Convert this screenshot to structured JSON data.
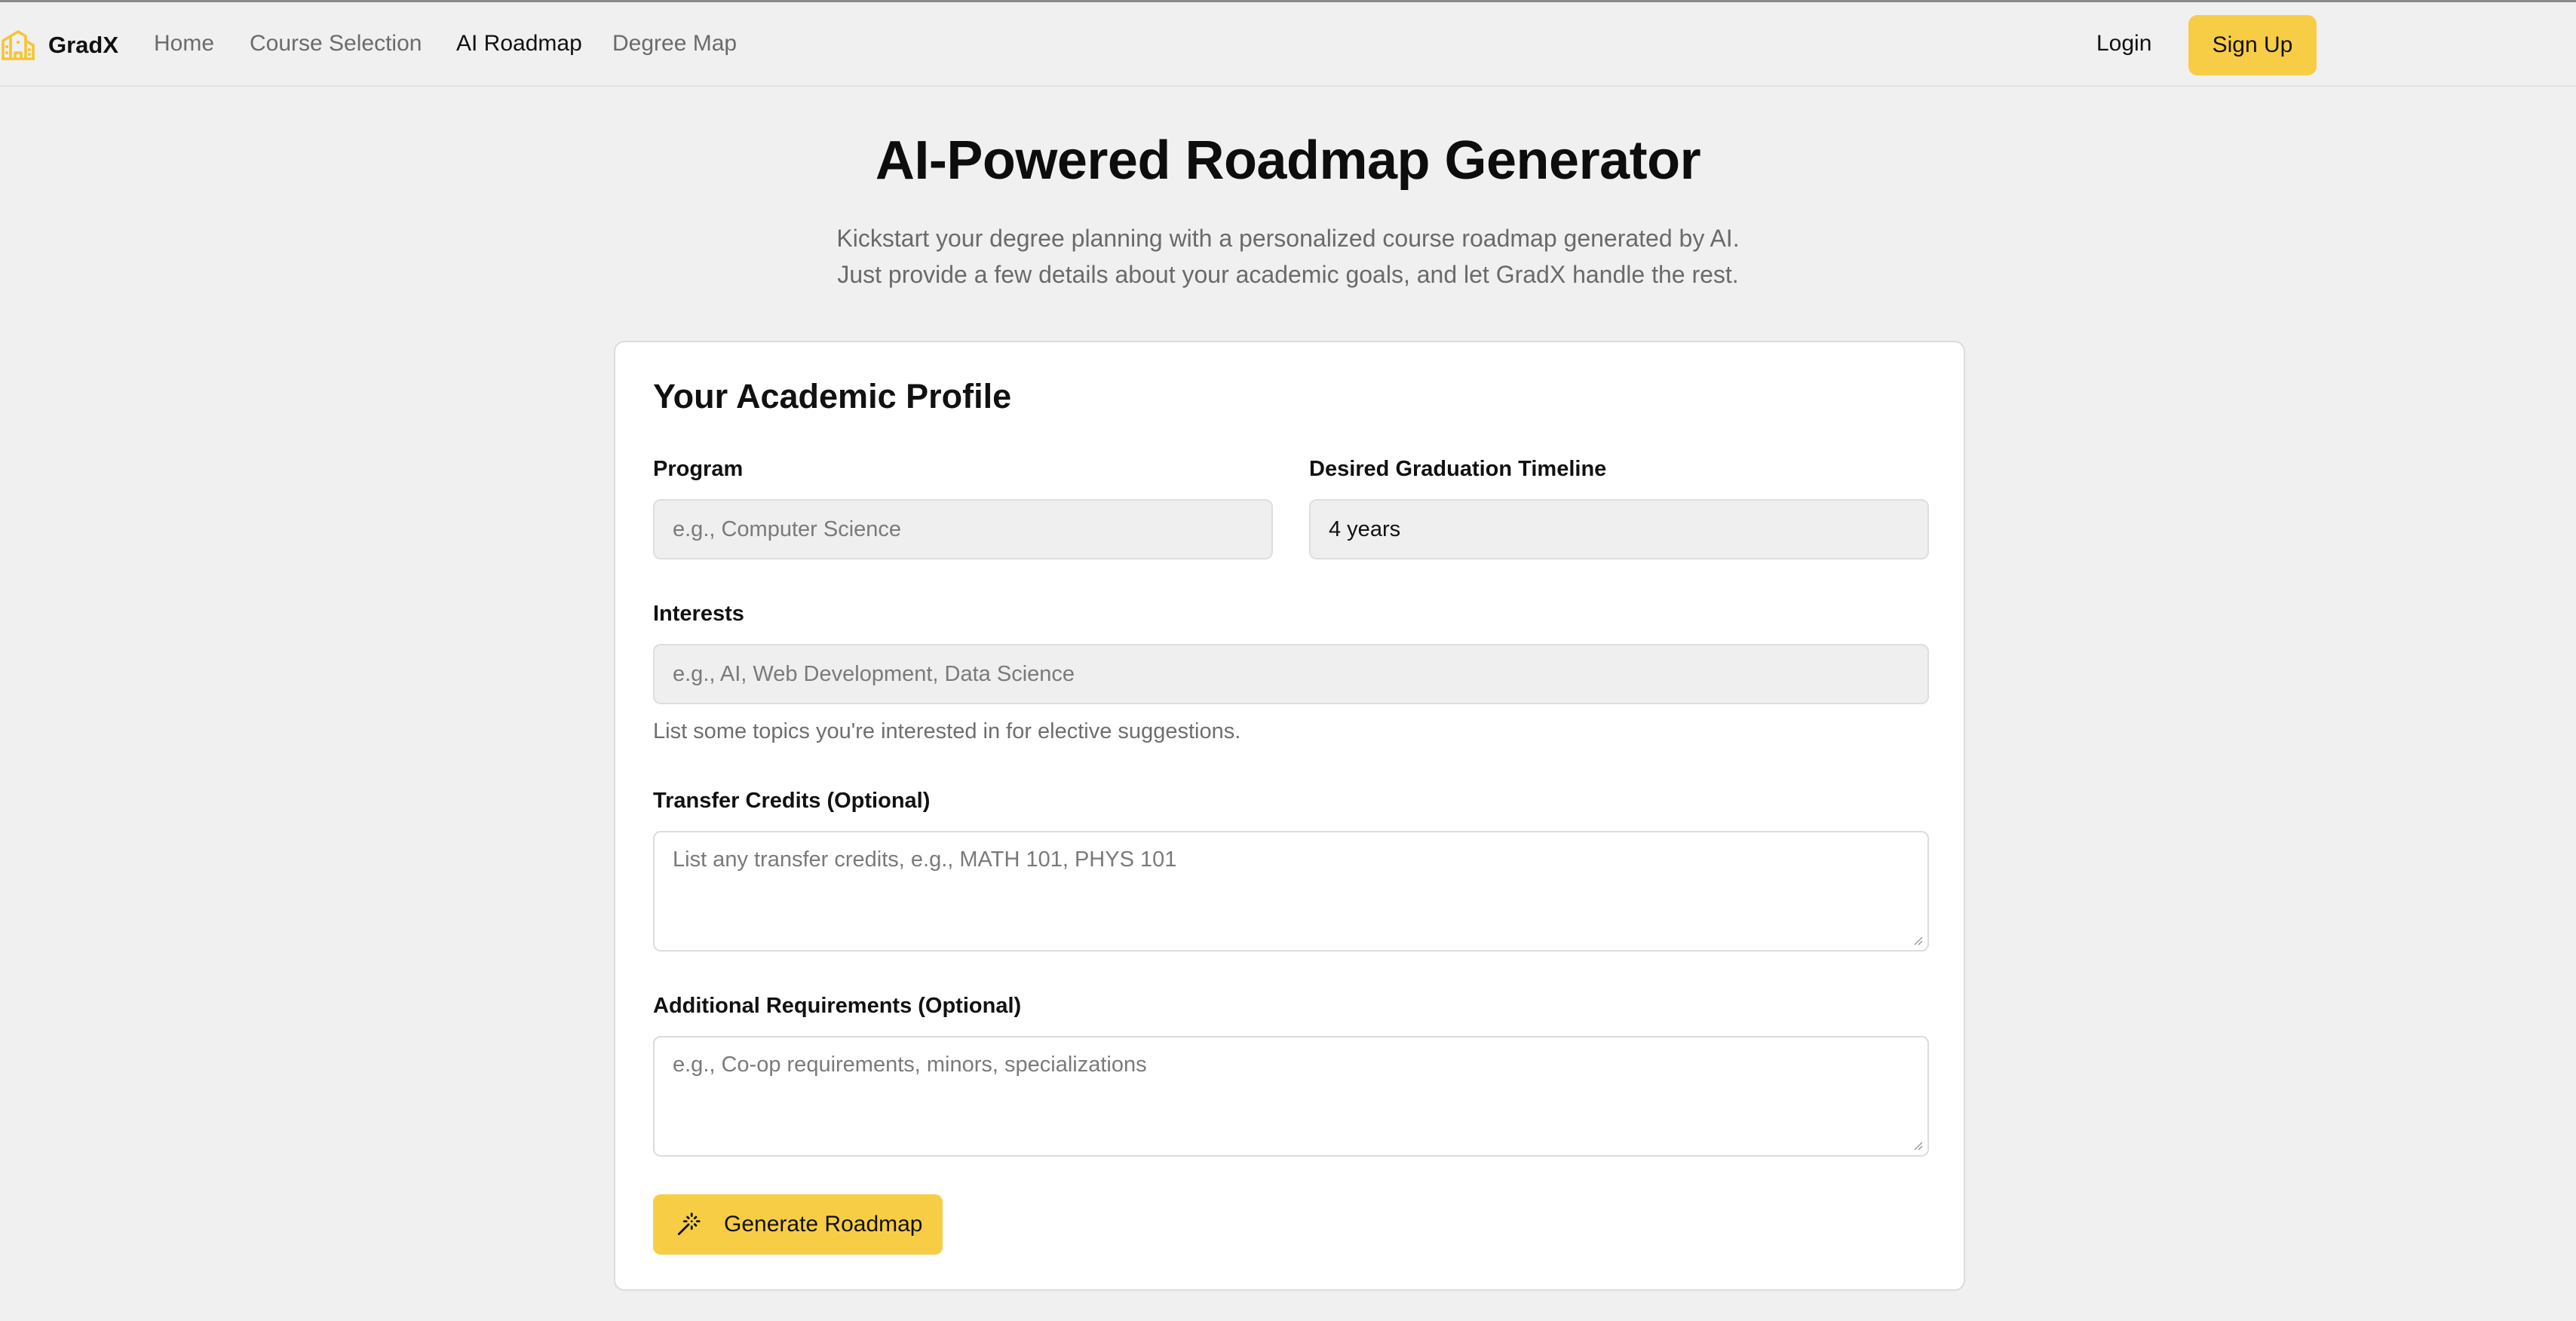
{
  "nav": {
    "brand": "GradX",
    "links": [
      {
        "label": "Home",
        "active": false
      },
      {
        "label": "Course Selection",
        "active": false
      },
      {
        "label": "AI Roadmap",
        "active": true
      },
      {
        "label": "Degree Map",
        "active": false
      }
    ],
    "login": "Login",
    "signup": "Sign Up",
    "accent_color": "#f8cd46"
  },
  "hero": {
    "title": "AI-Powered Roadmap Generator",
    "subtitle_line1": "Kickstart your degree planning with a personalized course roadmap generated by AI.",
    "subtitle_line2": "Just provide a few details about your academic goals, and let GradX handle the rest."
  },
  "form": {
    "title": "Your Academic Profile",
    "program": {
      "label": "Program",
      "value": "",
      "placeholder": "e.g., Computer Science"
    },
    "timeline": {
      "label": "Desired Graduation Timeline",
      "value": "4 years"
    },
    "interests": {
      "label": "Interests",
      "value": "",
      "placeholder": "e.g., AI, Web Development, Data Science",
      "help": "List some topics you're interested in for elective suggestions."
    },
    "transfer_credits": {
      "label": "Transfer Credits (Optional)",
      "value": "",
      "placeholder": "List any transfer credits, e.g., MATH 101, PHYS 101"
    },
    "additional_requirements": {
      "label": "Additional Requirements (Optional)",
      "value": "",
      "placeholder": "e.g., Co-op requirements, minors, specializations"
    },
    "submit": {
      "label": "Generate Roadmap",
      "icon": "magic-wand-icon"
    }
  }
}
